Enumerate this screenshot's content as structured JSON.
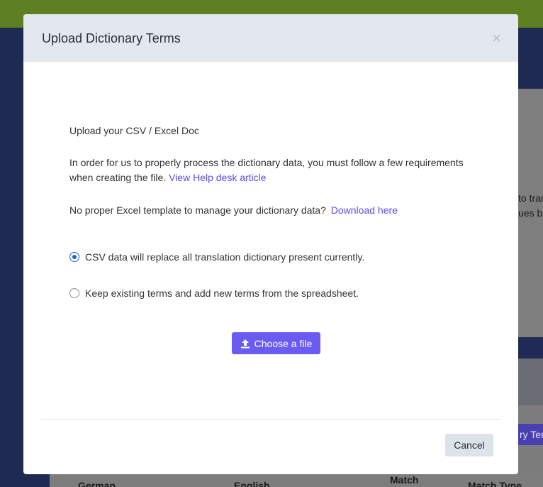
{
  "background": {
    "snippets": [
      "to tran",
      "ues b"
    ],
    "button_label": "ry Ter",
    "table_headers": [
      "German",
      "English",
      "Match",
      "Match Type"
    ]
  },
  "modal": {
    "title": "Upload Dictionary Terms",
    "close_symbol": "×",
    "heading": "Upload your CSV / Excel Doc",
    "requirements_text": "In order for us to properly process the dictionary data, you must follow a few requirements when creating the file.",
    "help_link": "View Help desk article",
    "template_text": "No proper Excel template to manage your dictionary data?",
    "download_link": "Download here",
    "options": [
      {
        "label": "CSV data will replace all translation dictionary present currently.",
        "checked": true
      },
      {
        "label": "Keep existing terms and add new terms from the spreadsheet.",
        "checked": false
      }
    ],
    "choose_file_label": "Choose a file",
    "choose_file_icon": "upload-icon",
    "cancel_label": "Cancel"
  },
  "colors": {
    "accent": "#6a5cf2",
    "link": "#5a4de6",
    "radio": "#1a63d6"
  }
}
